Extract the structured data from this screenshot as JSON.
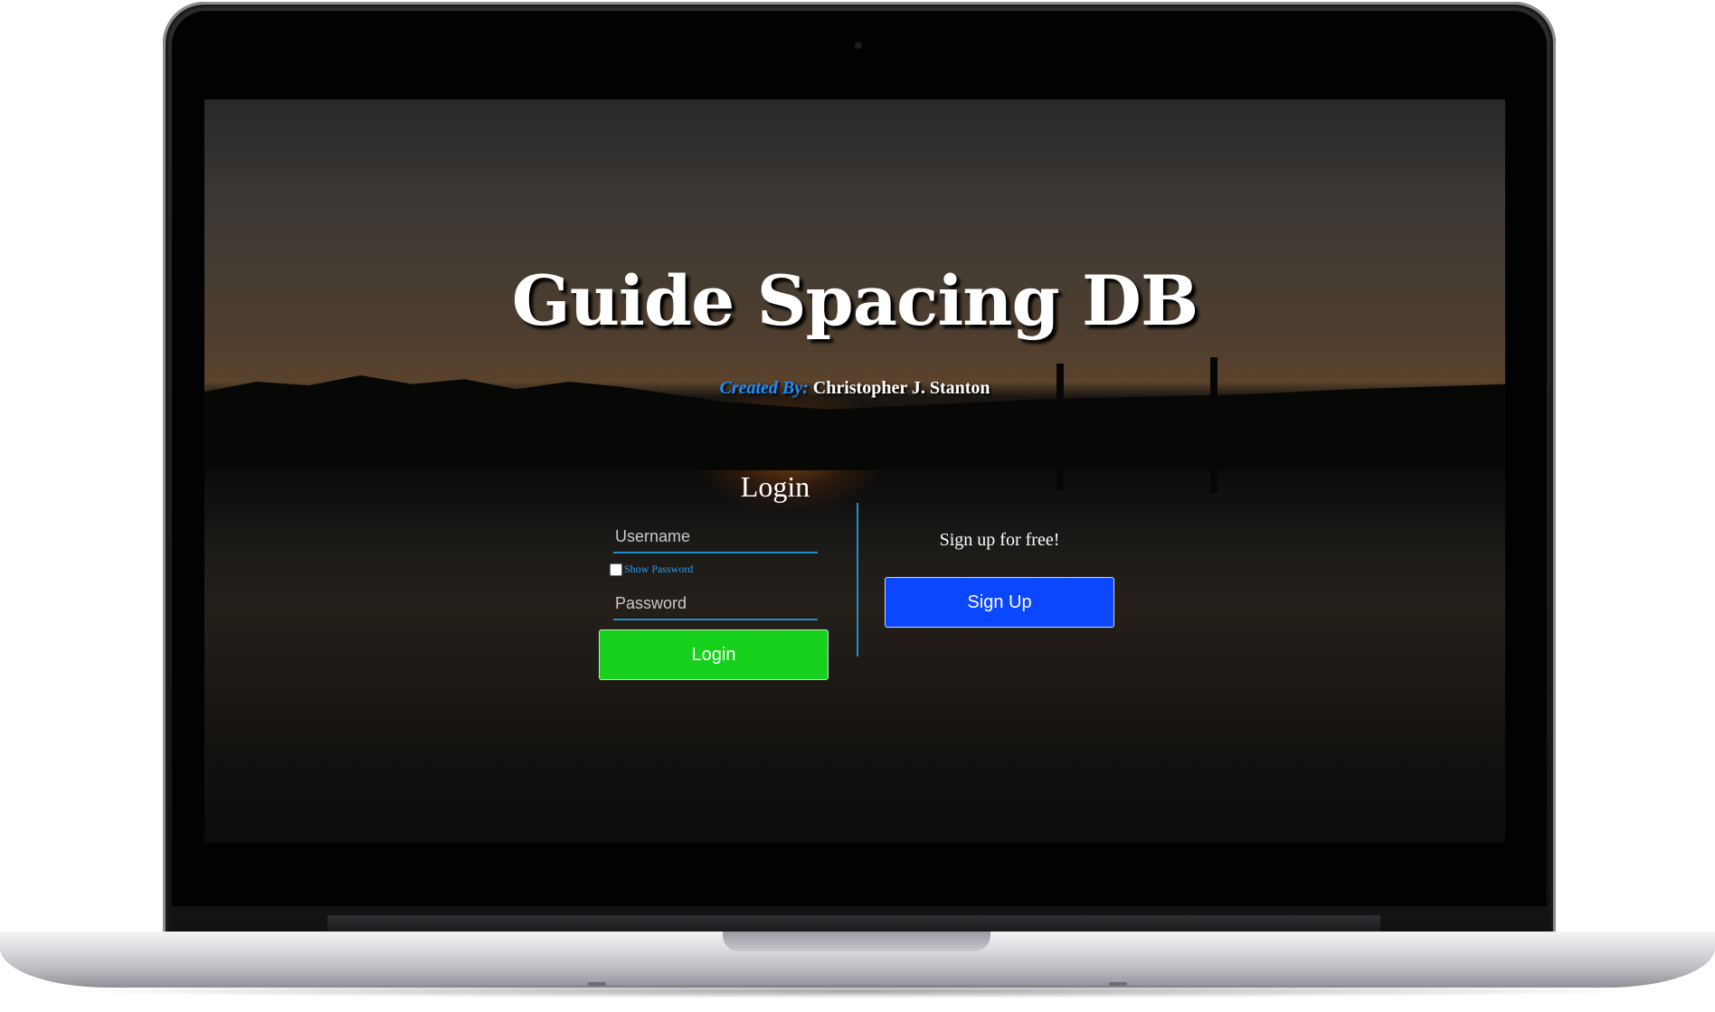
{
  "app": {
    "title": "Guide Spacing DB",
    "credit_label": "Created By:",
    "credit_name": "Christopher J. Stanton"
  },
  "login": {
    "heading": "Login",
    "username_placeholder": "Username",
    "show_password_label": "Show Password",
    "password_placeholder": "Password",
    "button_label": "Login"
  },
  "signup": {
    "prompt": "Sign up for free!",
    "button_label": "Sign Up"
  },
  "colors": {
    "login_button": "#17d11d",
    "signup_button": "#0a47ff",
    "accent_blue": "#1e8fc8",
    "credit_label": "#1e90ff"
  }
}
